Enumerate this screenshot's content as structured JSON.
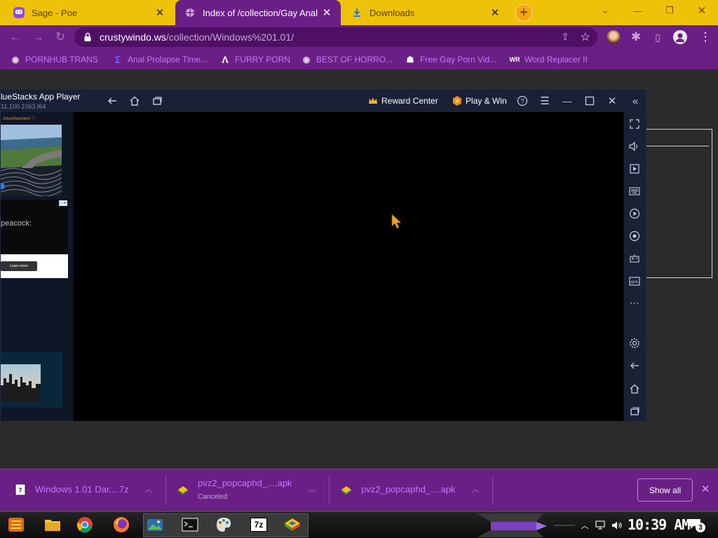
{
  "browser": {
    "tabs": [
      {
        "title": "Sage - Poe",
        "icon": "poe-icon",
        "active": false
      },
      {
        "title": "Index of /collection/Gay Anal",
        "icon": "globe-icon",
        "active": true
      },
      {
        "title": "Downloads",
        "icon": "download-icon",
        "active": false
      }
    ],
    "new_tab_label": "+",
    "address": {
      "host": "crustywindo.ws",
      "path": "/collection/Windows%201.01/"
    },
    "bookmarks": [
      {
        "label": "PORNHUB TRANS",
        "icon": "globe-icon"
      },
      {
        "label": "Anal Prolapse Time...",
        "icon": "bracket-icon"
      },
      {
        "label": "FURRY PORN",
        "icon": "lambda-icon"
      },
      {
        "label": "BEST OF HORRO...",
        "icon": "globe-icon"
      },
      {
        "label": "Free Gay Porn Vid...",
        "icon": "site-icon"
      },
      {
        "label": "Word Replacer II",
        "icon": "wr-icon"
      }
    ],
    "accent": "#6a1f86",
    "tab_strip_color": "#efc20a"
  },
  "bluestacks": {
    "app_name": "lueStacks App Player",
    "version": "11.100.1063 t64",
    "reward_center": "Reward Center",
    "play_win": "Play & Win",
    "ad_label": "Advertisement ⓘ",
    "ad_brand": "peacock:",
    "ad_button": "Learn more",
    "ad_close": "▷✕",
    "rail_icons": [
      "fullscreen-icon",
      "volume-icon",
      "media-icon",
      "keyboard-icon",
      "macro-icon",
      "rotate-icon",
      "gamepad-icon",
      "apk-icon",
      "more-icon",
      "settings-icon",
      "back-icon",
      "home-icon",
      "recents-icon"
    ]
  },
  "downloads": {
    "items": [
      {
        "name": "Windows 1.01 Dar....7z",
        "status": "",
        "icon": "7z-file-icon"
      },
      {
        "name": "pvz2_popcaphd_....apk",
        "status": "Canceled",
        "icon": "apk-file-icon"
      },
      {
        "name": "pvz2_popcaphd_....apk",
        "status": "",
        "icon": "apk-file-icon"
      }
    ],
    "show_all": "Show all"
  },
  "taskbar": {
    "apps": [
      "start-icon",
      "file-explorer-icon",
      "chrome-icon",
      "firefox-icon",
      "image-viewer-icon",
      "terminal-icon",
      "paint-icon",
      "7zip-icon",
      "bluestacks-icon"
    ],
    "clock": "10:39 AM",
    "notification_count": "3",
    "seven_zip_label": "7z"
  }
}
